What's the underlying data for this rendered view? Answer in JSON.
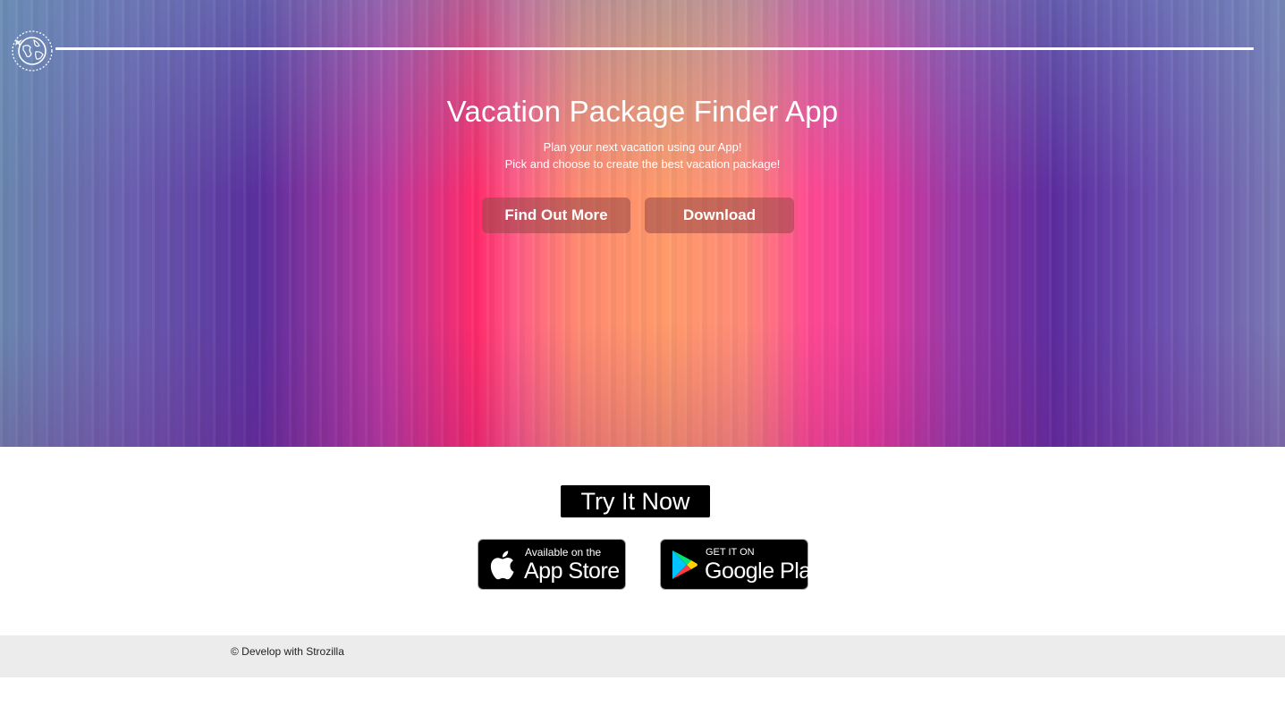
{
  "header": {
    "logo_icon": "globe-airplane-icon"
  },
  "hero": {
    "title": "Vacation Package Finder App",
    "subtitle_line1": "Plan your next vacation using our App!",
    "subtitle_line2": "Pick and choose to create the best vacation package!",
    "buttons": {
      "find_out_more": "Find Out More",
      "download": "Download"
    }
  },
  "try_section": {
    "heading": "Try It Now",
    "app_store": {
      "icon": "apple-icon",
      "small_text": "Available on the",
      "big_text": "App Store"
    },
    "google_play": {
      "icon": "google-play-icon",
      "small_text": "GET IT ON",
      "big_text": "Google Play"
    }
  },
  "footer": {
    "copyright": "© Develop with Strozilla"
  },
  "colors": {
    "button_bg": "#964646",
    "footer_bg": "#ececec",
    "badge_bg": "#000000"
  }
}
